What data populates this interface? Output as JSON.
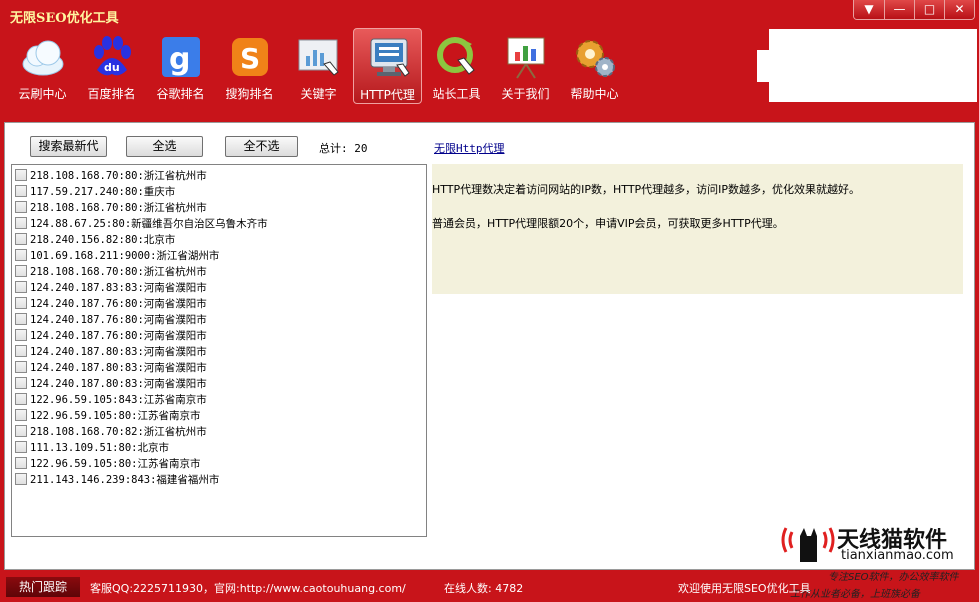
{
  "app": {
    "title": "无限SEO优化工具"
  },
  "toolbar": {
    "items": [
      {
        "label": "云刷中心",
        "icon": "cloud-icon"
      },
      {
        "label": "百度排名",
        "icon": "baidu-paw-icon"
      },
      {
        "label": "谷歌排名",
        "icon": "google-icon"
      },
      {
        "label": "搜狗排名",
        "icon": "sogou-icon"
      },
      {
        "label": "关键字",
        "icon": "keyword-chart-icon"
      },
      {
        "label": "HTTP代理",
        "icon": "monitor-proxy-icon"
      },
      {
        "label": "站长工具",
        "icon": "refresh-hand-icon"
      },
      {
        "label": "关于我们",
        "icon": "easel-chart-icon"
      },
      {
        "label": "帮助中心",
        "icon": "gears-icon"
      }
    ],
    "active_index": 5
  },
  "controls": {
    "search_label": "搜索最新代",
    "select_all_label": "全选",
    "deselect_all_label": "全不选",
    "total_label": "总计: 20",
    "link_label": "无限Http代理"
  },
  "proxies": [
    "218.108.168.70:80:浙江省杭州市",
    "117.59.217.240:80:重庆市",
    "218.108.168.70:80:浙江省杭州市",
    "124.88.67.25:80:新疆维吾尔自治区乌鲁木齐市",
    "218.240.156.82:80:北京市",
    "101.69.168.211:9000:浙江省湖州市",
    "218.108.168.70:80:浙江省杭州市",
    "124.240.187.83:83:河南省濮阳市",
    "124.240.187.76:80:河南省濮阳市",
    "124.240.187.76:80:河南省濮阳市",
    "124.240.187.76:80:河南省濮阳市",
    "124.240.187.80:83:河南省濮阳市",
    "124.240.187.80:83:河南省濮阳市",
    "124.240.187.80:83:河南省濮阳市",
    "122.96.59.105:843:江苏省南京市",
    "122.96.59.105:80:江苏省南京市",
    "218.108.168.70:82:浙江省杭州市",
    "111.13.109.51:80:北京市",
    "122.96.59.105:80:江苏省南京市",
    "211.143.146.239:843:福建省福州市"
  ],
  "info": {
    "line1": "HTTP代理数决定着访问网站的IP数，HTTP代理越多，访问IP数越多，优化效果就越好。",
    "line2": "普通会员，HTTP代理限额20个，申请VIP会员，可获取更多HTTP代理。"
  },
  "statusbar": {
    "hot_label": "热门跟踪",
    "service_text": "客服QQ:2225711930，官网:http://www.caotouhuang.com/",
    "online_text": "在线人数: 4782",
    "welcome_text": "欢迎使用无限SEO优化工具"
  },
  "watermark": {
    "name": "天线猫软件",
    "url": "tianxianmao.com",
    "slogan1": "专注SEO软件，办公效率软件",
    "slogan2": "工作从业者必备，上班族必备"
  }
}
